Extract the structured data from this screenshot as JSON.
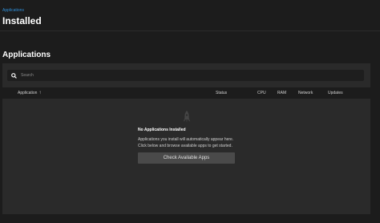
{
  "breadcrumb": {
    "label": "Applications"
  },
  "header": {
    "title": "Installed"
  },
  "section": {
    "title": "Applications"
  },
  "search": {
    "placeholder": "Search",
    "value": ""
  },
  "table": {
    "columns": [
      "Application",
      "Status",
      "CPU",
      "RAM",
      "Network",
      "Updates"
    ],
    "sort_indicator": "↑"
  },
  "empty_state": {
    "icon": "rocket-icon",
    "title": "No Applications Installed",
    "description": "Applications you install will automatically appear here. Click below and browse available apps to get started.",
    "button_label": "Check Available Apps"
  },
  "colors": {
    "background": "#1c1c1c",
    "card": "#2a2a2a",
    "link": "#2f8fd8",
    "button": "#4a4a4a"
  }
}
